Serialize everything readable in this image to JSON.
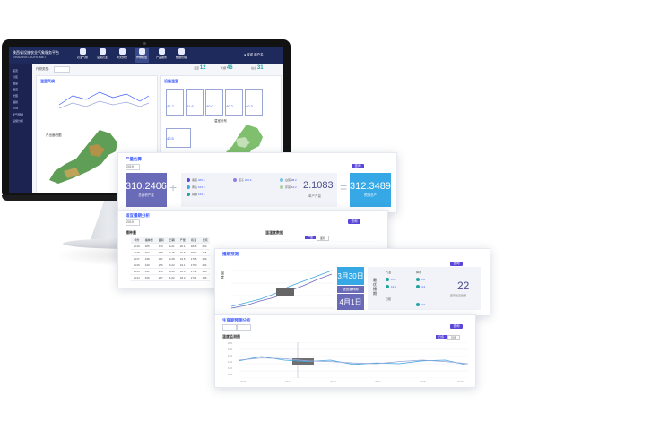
{
  "monitor": {
    "brand": "陕西省设施农业气象服务平台",
    "brand_sub": "SHAANXI AGRI-MET",
    "nav": [
      "农业气象",
      "设施农业",
      "灾害预警",
      "作物模型",
      "产品服务",
      "数据管理"
    ],
    "user": "欢迎 用户名",
    "sidebar": [
      "首页",
      "分区",
      "温度",
      "湿度",
      "光照",
      "辐射",
      "CO2",
      "天气预报",
      "设施分析"
    ],
    "filter_label": "作物类型:",
    "kpis": [
      {
        "label": "温室",
        "value": "12"
      },
      {
        "label": "大棚",
        "value": "46"
      },
      {
        "label": "站点",
        "value": "31"
      }
    ],
    "left_panel_title": "温室气候",
    "right_panel_title": "设施温室",
    "left_map_title": "产出面积图",
    "right_map_title": "温室分布",
    "metrics": [
      "41.2",
      "41.6",
      "40.0",
      "40.2",
      "40.3",
      "40.5"
    ]
  },
  "card1": {
    "title": "产量估算",
    "year": "2019",
    "left_value": "310.2406",
    "left_label": "总面积产量",
    "mid_items": [
      {
        "name": "番茄",
        "value": "465.6"
      },
      {
        "name": "黄瓜",
        "value": "164.9"
      },
      {
        "name": "辣椒",
        "value": "123.4"
      },
      {
        "name": "茄子",
        "value": "200.4"
      },
      {
        "name": "白菜",
        "value": "98.2"
      },
      {
        "name": "芹菜",
        "value": "64.2"
      }
    ],
    "mid_value": "2.1083",
    "mid_label": "单产产量",
    "right_value": "312.3489",
    "right_label": "预测总产",
    "op_plus": "+",
    "op_eq": "=",
    "button": "查询"
  },
  "card2": {
    "title": "适宜播期分析",
    "year": "2019",
    "table_title": "播种量",
    "chart_title": "温湿度数据",
    "headers": [
      "年份",
      "播种量",
      "面积",
      "日期",
      "产量",
      "积温",
      "日照"
    ],
    "rows": [
      [
        "2019",
        "465",
        "310",
        "3-21",
        "20.1",
        "1846",
        "220"
      ],
      [
        "2018",
        "452",
        "308",
        "3-25",
        "19.8",
        "1802",
        "215"
      ],
      [
        "2017",
        "448",
        "301",
        "3-28",
        "19.5",
        "1795",
        "209"
      ],
      [
        "2016",
        "440",
        "296",
        "3-22",
        "19.1",
        "1760",
        "204"
      ],
      [
        "2015",
        "431",
        "290",
        "3-30",
        "18.6",
        "1732",
        "198"
      ],
      [
        "2014",
        "425",
        "287",
        "4-02",
        "18.2",
        "1701",
        "195"
      ]
    ],
    "tabs": [
      "产量",
      "面积"
    ],
    "button": "查询"
  },
  "card3": {
    "title": "播期预测",
    "date1": "3月30日",
    "note": "适宜播种期",
    "date2": "4月1日",
    "side_text": "最优播期",
    "days": "22",
    "days_label": "距离适宜播期",
    "stat_labels": [
      "气温",
      "降水",
      "日照"
    ],
    "stat_values": [
      "15.2",
      "12.4",
      "6.8",
      "4.2",
      "3.9"
    ],
    "axis_label": "温度",
    "button": "查询"
  },
  "card4": {
    "title": "生育期预测分析",
    "chart_title": "温度监测图",
    "tabs": [
      "日值",
      "月值"
    ],
    "x_ticks": [
      "2011",
      "2012",
      "2013",
      "2014",
      "2015",
      "2016"
    ],
    "y_ticks": [
      "200",
      "180",
      "160",
      "140",
      "120",
      "100"
    ],
    "button": "查询"
  },
  "chart_data": [
    {
      "type": "line",
      "title": "温度监测图",
      "x": [
        0,
        1,
        2,
        3,
        4,
        5,
        6,
        7,
        8,
        9,
        10
      ],
      "series": [
        {
          "values": [
            148,
            160,
            150,
            146,
            150,
            138,
            142,
            140,
            148,
            150,
            136
          ]
        },
        {
          "values": [
            150,
            156,
            154,
            148,
            146,
            142,
            140,
            146,
            150,
            146,
            140
          ]
        }
      ],
      "ylim": [
        100,
        200
      ]
    },
    {
      "type": "line",
      "title": "温湿度数据",
      "x": [
        0,
        1,
        2,
        3,
        4,
        5,
        6,
        7,
        8
      ],
      "series": [
        {
          "values": [
            10,
            22,
            32,
            40,
            48,
            55,
            60,
            66,
            70
          ]
        },
        {
          "values": [
            12,
            26,
            34,
            44,
            52,
            58,
            64,
            70,
            74
          ]
        }
      ],
      "ylim": [
        0,
        100
      ]
    }
  ],
  "colors": {
    "accent": "#5a46d8",
    "navy": "#1f2a5c",
    "teal": "#1fa3a3",
    "sky": "#3fa7e0",
    "lavender": "#6a6bb8"
  }
}
